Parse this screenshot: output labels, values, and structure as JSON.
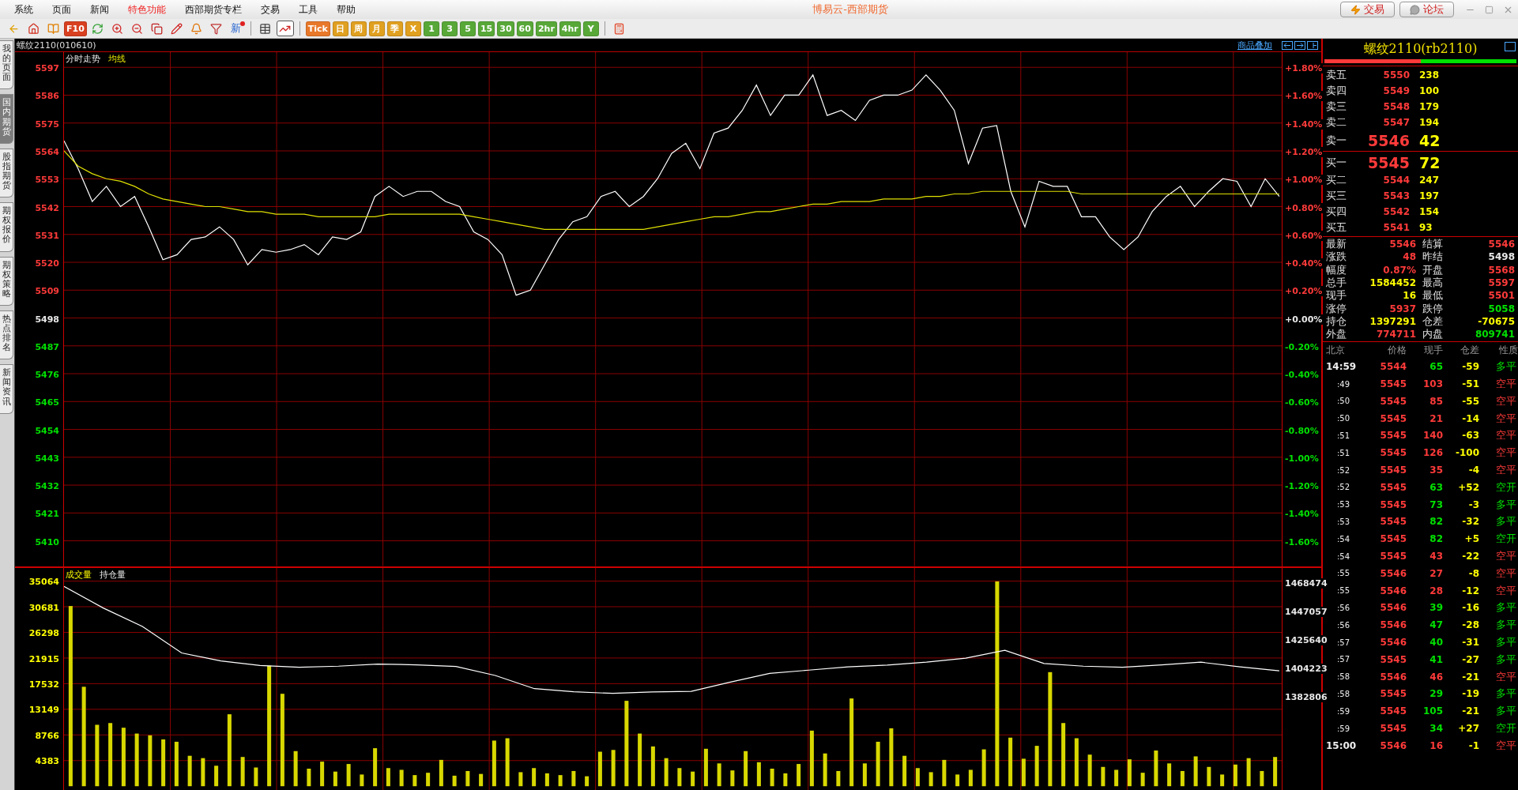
{
  "window": {
    "title": "博易云-西部期货",
    "buttons": [
      {
        "label": "交易"
      },
      {
        "label": "论坛"
      }
    ]
  },
  "menu": [
    {
      "label": "系统",
      "highlighted": false
    },
    {
      "label": "页面",
      "highlighted": false
    },
    {
      "label": "新闻",
      "highlighted": false
    },
    {
      "label": "特色功能",
      "highlighted": true
    },
    {
      "label": "西部期货专栏",
      "highlighted": false
    },
    {
      "label": "交易",
      "highlighted": false
    },
    {
      "label": "工具",
      "highlighted": false
    },
    {
      "label": "帮助",
      "highlighted": false
    }
  ],
  "toolbar": {
    "tools": [
      {
        "selected": false
      },
      {
        "selected": false
      },
      {
        "selected": false
      },
      {
        "label": "F10",
        "selected": false
      },
      {
        "selected": false
      },
      {
        "selected": false
      },
      {
        "selected": false
      },
      {
        "selected": false
      },
      {
        "selected": false
      },
      {
        "selected": false
      },
      {
        "selected": false
      },
      {
        "label": "新",
        "selected": false
      },
      {
        "selected": false
      },
      {
        "selected": true
      }
    ],
    "periods": [
      {
        "label": "Tick",
        "color": "#e8782a"
      },
      {
        "label": "日",
        "color": "#e0a020"
      },
      {
        "label": "周",
        "color": "#e0a020"
      },
      {
        "label": "月",
        "color": "#e0a020"
      },
      {
        "label": "季",
        "color": "#e0a020"
      },
      {
        "label": "X",
        "color": "#e0a020"
      },
      {
        "label": "1",
        "color": "#58a838"
      },
      {
        "label": "3",
        "color": "#58a838"
      },
      {
        "label": "5",
        "color": "#58a838"
      },
      {
        "label": "15",
        "color": "#58a838"
      },
      {
        "label": "30",
        "color": "#58a838"
      },
      {
        "label": "60",
        "color": "#58a838"
      },
      {
        "label": "2hr",
        "color": "#58a838"
      },
      {
        "label": "4hr",
        "color": "#58a838"
      },
      {
        "label": "Y",
        "color": "#58a838"
      }
    ]
  },
  "side_tabs": [
    {
      "label": "我的页面",
      "selected": false
    },
    {
      "label": "国内期货",
      "selected": true
    },
    {
      "label": "股指期货",
      "selected": false
    },
    {
      "label": "期权报价",
      "selected": false
    },
    {
      "label": "期权策略",
      "selected": false
    },
    {
      "label": "热点排名",
      "selected": false
    },
    {
      "label": "新闻资讯",
      "selected": false
    }
  ],
  "chart_header": {
    "symbol": "螺纹2110(010610)",
    "overlay_link": "商品叠加"
  },
  "price_panel": {
    "percent_labels": [
      {
        "label": "+1.80%",
        "color": "#ff3a3a"
      },
      {
        "label": "+1.60%",
        "color": "#ff3a3a"
      },
      {
        "label": "+1.40%",
        "color": "#ff3a3a"
      },
      {
        "label": "+1.20%",
        "color": "#ff3a3a"
      },
      {
        "label": "+1.00%",
        "color": "#ff3a3a"
      },
      {
        "label": "+0.80%",
        "color": "#ff3a3a"
      },
      {
        "label": "+0.60%",
        "color": "#ff3a3a"
      },
      {
        "label": "+0.40%",
        "color": "#ff3a3a"
      },
      {
        "label": "+0.20%",
        "color": "#ff3a3a"
      },
      {
        "label": "+0.00%",
        "color": "#e8e8e8"
      },
      {
        "label": "-0.20%",
        "color": "#00e000"
      },
      {
        "label": "-0.40%",
        "color": "#00e000"
      },
      {
        "label": "-0.60%",
        "color": "#00e000"
      },
      {
        "label": "-0.80%",
        "color": "#00e000"
      },
      {
        "label": "-1.00%",
        "color": "#00e000"
      },
      {
        "label": "-1.20%",
        "color": "#00e000"
      },
      {
        "label": "-1.40%",
        "color": "#00e000"
      },
      {
        "label": "-1.60%",
        "color": "#00e000"
      }
    ],
    "chart_data": {
      "type": "line",
      "grid": true,
      "ylim": [
        5400,
        5603
      ],
      "yticks": [
        {
          "value": 5597,
          "label": "5597"
        },
        {
          "value": 5586,
          "label": "5586"
        },
        {
          "value": 5575,
          "label": "5575"
        },
        {
          "value": 5564,
          "label": "5564"
        },
        {
          "value": 5553,
          "label": "5553"
        },
        {
          "value": 5542,
          "label": "5542"
        },
        {
          "value": 5531,
          "label": "5531"
        },
        {
          "value": 5520,
          "label": "5520"
        },
        {
          "value": 5509,
          "label": "5509"
        },
        {
          "value": 5498,
          "label": "5498"
        },
        {
          "value": 5487,
          "label": "5487"
        },
        {
          "value": 5476,
          "label": "5476"
        },
        {
          "value": 5465,
          "label": "5465"
        },
        {
          "value": 5454,
          "label": "5454"
        },
        {
          "value": 5443,
          "label": "5443"
        },
        {
          "value": 5432,
          "label": "5432"
        },
        {
          "value": 5421,
          "label": "5421"
        },
        {
          "value": 5410,
          "label": "5410"
        }
      ],
      "series": [
        {
          "name": "分时走势",
          "color": "#ffffff",
          "values": [
            5568,
            5557,
            5544,
            5550,
            5542,
            5546,
            5534,
            5521,
            5523,
            5529,
            5530,
            5534,
            5529,
            5519,
            5525,
            5524,
            5525,
            5527,
            5523,
            5530,
            5529,
            5532,
            5546,
            5550,
            5546,
            5548,
            5548,
            5544,
            5542,
            5532,
            5529,
            5523,
            5507,
            5509,
            5519,
            5529,
            5536,
            5538,
            5546,
            5548,
            5542,
            5546,
            5553,
            5563,
            5567,
            5557,
            5571,
            5573,
            5580,
            5590,
            5578,
            5586,
            5586,
            5594,
            5578,
            5580,
            5576,
            5584,
            5586,
            5586,
            5588,
            5594,
            5588,
            5580,
            5559,
            5573,
            5574,
            5548,
            5534,
            5552,
            5550,
            5550,
            5538,
            5538,
            5530,
            5525,
            5530,
            5540,
            5546,
            5550,
            5542,
            5548,
            5553,
            5552,
            5542,
            5553,
            5546
          ]
        },
        {
          "name": "均线",
          "color": "#e0e000",
          "values": [
            5564,
            5558,
            5555,
            5553,
            5552,
            5550,
            5547,
            5545,
            5544,
            5543,
            5542,
            5542,
            5541,
            5540,
            5540,
            5539,
            5539,
            5539,
            5538,
            5538,
            5538,
            5538,
            5538,
            5539,
            5539,
            5539,
            5539,
            5539,
            5539,
            5538,
            5537,
            5536,
            5535,
            5534,
            5533,
            5533,
            5533,
            5533,
            5533,
            5533,
            5533,
            5533,
            5534,
            5535,
            5536,
            5537,
            5538,
            5538,
            5539,
            5540,
            5540,
            5541,
            5542,
            5543,
            5543,
            5544,
            5544,
            5544,
            5545,
            5545,
            5545,
            5546,
            5546,
            5547,
            5547,
            5548,
            5548,
            5548,
            5548,
            5548,
            5548,
            5548,
            5547,
            5547,
            5547,
            5547,
            5547,
            5547,
            5547,
            5547,
            5547,
            5547,
            5547,
            5547,
            5547,
            5547,
            5547
          ]
        }
      ]
    }
  },
  "volume_panel": {
    "chart_data": {
      "type": "bar",
      "grid": true,
      "ylim": [
        -700,
        37300
      ],
      "yticks": [
        {
          "value": 35064,
          "label": "35064"
        },
        {
          "value": 30681,
          "label": "30681"
        },
        {
          "value": 26298,
          "label": "26298"
        },
        {
          "value": 21915,
          "label": "21915"
        },
        {
          "value": 17532,
          "label": "17532"
        },
        {
          "value": 13149,
          "label": "13149"
        },
        {
          "value": 8766,
          "label": "8766"
        },
        {
          "value": 4383,
          "label": "4383"
        }
      ],
      "series": [
        {
          "name": "成交量",
          "color": "#d8d800",
          "values": [
            30800,
            17000,
            10500,
            10800,
            10000,
            9000,
            8700,
            8000,
            7600,
            5200,
            4800,
            3500,
            12300,
            5000,
            3200,
            20600,
            15800,
            6000,
            3000,
            4200,
            2500,
            3800,
            2000,
            6500,
            3100,
            2800,
            1900,
            2300,
            4500,
            1800,
            2600,
            2100,
            7800,
            8200,
            2400,
            3100,
            2200,
            1900,
            2600,
            1700,
            5900,
            6200,
            14600,
            9000,
            6800,
            4800,
            3100,
            2500,
            6400,
            3900,
            2700,
            6000,
            4100,
            3000,
            2200,
            3800,
            9500,
            5600,
            2600,
            15000,
            3900,
            7600,
            9900,
            5200,
            3100,
            2400,
            4500,
            2000,
            2800,
            6300,
            35000,
            8300,
            4700,
            6900,
            19500,
            10800,
            8200,
            5400,
            3300,
            2800,
            4600,
            2300,
            6100,
            3900,
            2600,
            5100,
            3300,
            2000,
            3700,
            4800,
            2600,
            5000
          ]
        }
      ]
    },
    "open_interest": {
      "chart_data": {
        "type": "line",
        "ylim": [
          1382806,
          1468474
        ],
        "yticks": [
          {
            "value": 1468474,
            "label": "1468474"
          },
          {
            "value": 1447057,
            "label": "1447057"
          },
          {
            "value": 1425640,
            "label": "1425640"
          },
          {
            "value": 1404223,
            "label": "1404223"
          },
          {
            "value": 1382806,
            "label": "1382806"
          }
        ],
        "series": [
          {
            "name": "持仓量",
            "color": "#ffffff",
            "values": [
              1465300,
              1449000,
              1435000,
              1415000,
              1409000,
              1405500,
              1404200,
              1405000,
              1406600,
              1406000,
              1404800,
              1398000,
              1388000,
              1385600,
              1384400,
              1385500,
              1386000,
              1393000,
              1399500,
              1402000,
              1404500,
              1405800,
              1408000,
              1411000,
              1417000,
              1407000,
              1405000,
              1404200,
              1406000,
              1408000,
              1404500,
              1401500
            ]
          }
        ]
      }
    }
  },
  "quote": {
    "title": "螺纹2110(rb2110)",
    "buy_sell_ratio": {
      "level": 0.5
    },
    "asks": [
      {
        "label": "卖五",
        "price": "5550",
        "volume": "238",
        "emphasized": false
      },
      {
        "label": "卖四",
        "price": "5549",
        "volume": "100",
        "emphasized": false
      },
      {
        "label": "卖三",
        "price": "5548",
        "volume": "179",
        "emphasized": false
      },
      {
        "label": "卖二",
        "price": "5547",
        "volume": "194",
        "emphasized": false
      },
      {
        "label": "卖一",
        "price": "5546",
        "volume": "42",
        "emphasized": true
      }
    ],
    "bids": [
      {
        "label": "买一",
        "price": "5545",
        "volume": "72",
        "emphasized": true
      },
      {
        "label": "买二",
        "price": "5544",
        "volume": "247",
        "emphasized": false
      },
      {
        "label": "买三",
        "price": "5543",
        "volume": "197",
        "emphasized": false
      },
      {
        "label": "买四",
        "price": "5542",
        "volume": "154",
        "emphasized": false
      },
      {
        "label": "买五",
        "price": "5541",
        "volume": "93",
        "emphasized": false
      }
    ],
    "stats": [
      {
        "label": "最新",
        "value": "5546",
        "color": "#ff3a3a"
      },
      {
        "label": "结算",
        "value": "5546",
        "color": "#ff3a3a"
      },
      {
        "label": "涨跌",
        "value": "48",
        "color": "#ff3a3a"
      },
      {
        "label": "昨结",
        "value": "5498",
        "color": "#e8e8e8"
      },
      {
        "label": "幅度",
        "value": "0.87%",
        "color": "#ff3a3a"
      },
      {
        "label": "开盘",
        "value": "5568",
        "color": "#ff3a3a"
      },
      {
        "label": "总手",
        "value": "1584452",
        "color": "#ffff00"
      },
      {
        "label": "最高",
        "value": "5597",
        "color": "#ff3a3a"
      },
      {
        "label": "现手",
        "value": "16",
        "color": "#ffff00"
      },
      {
        "label": "最低",
        "value": "5501",
        "color": "#ff3a3a"
      },
      {
        "label": "涨停",
        "value": "5937",
        "color": "#ff3a3a"
      },
      {
        "label": "跌停",
        "value": "5058",
        "color": "#00e000"
      },
      {
        "label": "持仓",
        "value": "1397291",
        "color": "#ffff00"
      },
      {
        "label": "仓差",
        "value": "-70675",
        "color": "#ffff00"
      },
      {
        "label": "外盘",
        "value": "774711",
        "color": "#ff3a3a"
      },
      {
        "label": "内盘",
        "value": "809741",
        "color": "#00e000"
      }
    ]
  },
  "trades": {
    "columns": [
      "北京",
      "价格",
      "现手",
      "仓差",
      "性质"
    ],
    "rows": [
      {
        "time": "14:59",
        "kind": "full",
        "price": "5544",
        "volume": "65",
        "change": "-59",
        "nature": "多平",
        "color": "#00e000"
      },
      {
        "time": ":49",
        "kind": "short",
        "price": "5545",
        "volume": "103",
        "change": "-51",
        "nature": "空平",
        "color": "#ff3a3a"
      },
      {
        "time": ":50",
        "kind": "short",
        "price": "5545",
        "volume": "85",
        "change": "-55",
        "nature": "空平",
        "color": "#ff3a3a"
      },
      {
        "time": ":50",
        "kind": "short",
        "price": "5545",
        "volume": "21",
        "change": "-14",
        "nature": "空平",
        "color": "#ff3a3a"
      },
      {
        "time": ":51",
        "kind": "short",
        "price": "5545",
        "volume": "140",
        "change": "-63",
        "nature": "空平",
        "color": "#ff3a3a"
      },
      {
        "time": ":51",
        "kind": "short",
        "price": "5545",
        "volume": "126",
        "change": "-100",
        "nature": "空平",
        "color": "#ff3a3a"
      },
      {
        "time": ":52",
        "kind": "short",
        "price": "5545",
        "volume": "35",
        "change": "-4",
        "nature": "空平",
        "color": "#ff3a3a"
      },
      {
        "time": ":52",
        "kind": "short",
        "price": "5545",
        "volume": "63",
        "change": "+52",
        "nature": "空开",
        "color": "#00e000"
      },
      {
        "time": ":53",
        "kind": "short",
        "price": "5545",
        "volume": "73",
        "change": "-3",
        "nature": "多平",
        "color": "#00e000"
      },
      {
        "time": ":53",
        "kind": "short",
        "price": "5545",
        "volume": "82",
        "change": "-32",
        "nature": "多平",
        "color": "#00e000"
      },
      {
        "time": ":54",
        "kind": "short",
        "price": "5545",
        "volume": "82",
        "change": "+5",
        "nature": "空开",
        "color": "#00e000"
      },
      {
        "time": ":54",
        "kind": "short",
        "price": "5545",
        "volume": "43",
        "change": "-22",
        "nature": "空平",
        "color": "#ff3a3a"
      },
      {
        "time": ":55",
        "kind": "short",
        "price": "5546",
        "volume": "27",
        "change": "-8",
        "nature": "空平",
        "color": "#ff3a3a"
      },
      {
        "time": ":55",
        "kind": "short",
        "price": "5546",
        "volume": "28",
        "change": "-12",
        "nature": "空平",
        "color": "#ff3a3a"
      },
      {
        "time": ":56",
        "kind": "short",
        "price": "5546",
        "volume": "39",
        "change": "-16",
        "nature": "多平",
        "color": "#00e000"
      },
      {
        "time": ":56",
        "kind": "short",
        "price": "5546",
        "volume": "47",
        "change": "-28",
        "nature": "多平",
        "color": "#00e000"
      },
      {
        "time": ":57",
        "kind": "short",
        "price": "5546",
        "volume": "40",
        "change": "-31",
        "nature": "多平",
        "color": "#00e000"
      },
      {
        "time": ":57",
        "kind": "short",
        "price": "5545",
        "volume": "41",
        "change": "-27",
        "nature": "多平",
        "color": "#00e000"
      },
      {
        "time": ":58",
        "kind": "short",
        "price": "5546",
        "volume": "46",
        "change": "-21",
        "nature": "空平",
        "color": "#ff3a3a"
      },
      {
        "time": ":58",
        "kind": "short",
        "price": "5545",
        "volume": "29",
        "change": "-19",
        "nature": "多平",
        "color": "#00e000"
      },
      {
        "time": ":59",
        "kind": "short",
        "price": "5545",
        "volume": "105",
        "change": "-21",
        "nature": "多平",
        "color": "#00e000"
      },
      {
        "time": ":59",
        "kind": "short",
        "price": "5545",
        "volume": "34",
        "change": "+27",
        "nature": "空开",
        "color": "#00e000"
      },
      {
        "time": "15:00",
        "kind": "full",
        "price": "5546",
        "volume": "16",
        "change": "-1",
        "nature": "空平",
        "color": "#ff3a3a"
      }
    ]
  }
}
